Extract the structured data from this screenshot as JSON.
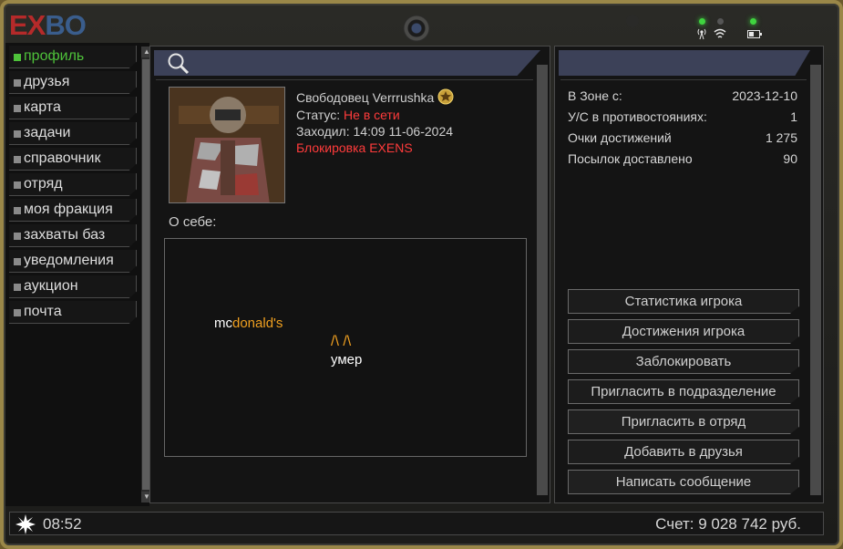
{
  "app": {
    "logo_left": "EX",
    "logo_right": "BO"
  },
  "sidebar": {
    "items": [
      {
        "label": "профиль",
        "active": true
      },
      {
        "label": "друзья"
      },
      {
        "label": "карта"
      },
      {
        "label": "задачи"
      },
      {
        "label": "справочник"
      },
      {
        "label": "отряд"
      },
      {
        "label": "моя фракция"
      },
      {
        "label": "захваты баз"
      },
      {
        "label": "уведомления"
      },
      {
        "label": "аукцион"
      },
      {
        "label": "почта"
      }
    ]
  },
  "profile": {
    "name": "Свободовец Verrrushka",
    "status_label": "Статус:",
    "status_value": "Не в сети",
    "last_seen_label": "Заходил:",
    "last_seen_value": "14:09 11-06-2024",
    "block_note": "Блокировка EXENS",
    "about_label": "О себе:",
    "about_text": {
      "mc": "mc",
      "donalds": "donald's",
      "arches": "/\\  /\\",
      "dead": "умер"
    }
  },
  "stats": [
    {
      "label": "В Зоне с:",
      "value": "2023-12-10"
    },
    {
      "label": "У/С в противостояниях:",
      "value": "1"
    },
    {
      "label": "Очки достижений",
      "value": "1 275"
    },
    {
      "label": "Посылок доставлено",
      "value": "90"
    }
  ],
  "actions": {
    "player_stats": "Статистика игрока",
    "player_achievements": "Достижения игрока",
    "block": "Заблокировать",
    "invite_subdivision": "Пригласить в подразделение",
    "invite_squad": "Пригласить в отряд",
    "add_friend": "Добавить в друзья",
    "send_message": "Написать сообщение"
  },
  "footer": {
    "time": "08:52",
    "balance": "Счет: 9 028 742 руб."
  },
  "colors": {
    "accent_green": "#4ec23a",
    "alert_red": "#ff3b3b",
    "orange": "#f0a020",
    "header_blue": "#3c4158"
  }
}
